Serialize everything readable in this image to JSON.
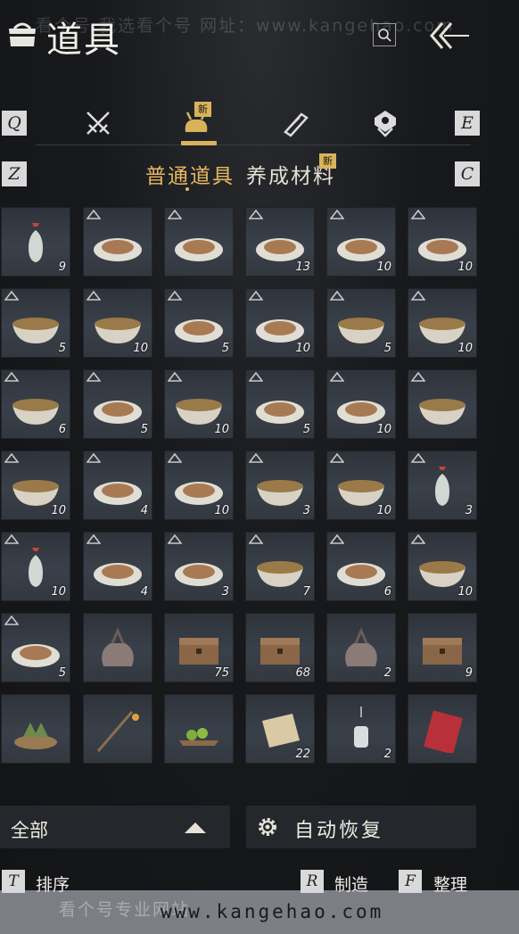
{
  "watermark_top": "看个号 我选看个号  网址：www.kangehao.com",
  "header": {
    "title": "道具"
  },
  "category_tabs": {
    "left_key": "Q",
    "right_key": "E",
    "new_badge": "新",
    "tabs": [
      {
        "icon": "crossed-swords-icon",
        "active": false
      },
      {
        "icon": "item-bag-icon",
        "active": true
      },
      {
        "icon": "scroll-icon",
        "active": false
      },
      {
        "icon": "map-marker-icon",
        "active": false
      }
    ]
  },
  "sub_tabs": {
    "left_key": "Z",
    "right_key": "C",
    "items": [
      {
        "label": "普通道具",
        "active": true
      },
      {
        "label": "养成材料",
        "active": false,
        "badge": "新"
      }
    ]
  },
  "grid": {
    "items": [
      {
        "icon": "vase-icon",
        "qty": "9",
        "rank": false
      },
      {
        "icon": "braised-pork-icon",
        "qty": "",
        "rank": true
      },
      {
        "icon": "tofu-bites-icon",
        "qty": "",
        "rank": true
      },
      {
        "icon": "flatbread-icon",
        "qty": "13",
        "rank": true
      },
      {
        "icon": "fish-dish-icon",
        "qty": "10",
        "rank": true
      },
      {
        "icon": "fish-dish-icon",
        "qty": "10",
        "rank": true
      },
      {
        "icon": "vegetable-bowl-icon",
        "qty": "5",
        "rank": true
      },
      {
        "icon": "vegetable-bowl-icon",
        "qty": "10",
        "rank": true
      },
      {
        "icon": "pancake-stack-icon",
        "qty": "5",
        "rank": true
      },
      {
        "icon": "steamed-bun-icon",
        "qty": "10",
        "rank": true
      },
      {
        "icon": "noodle-bowl-icon",
        "qty": "5",
        "rank": true
      },
      {
        "icon": "noodle-bowl-icon",
        "qty": "10",
        "rank": true
      },
      {
        "icon": "soup-bowl-icon",
        "qty": "6",
        "rank": true
      },
      {
        "icon": "red-dish-icon",
        "qty": "5",
        "rank": true
      },
      {
        "icon": "cup-soup-icon",
        "qty": "10",
        "rank": true
      },
      {
        "icon": "meat-plate-icon",
        "qty": "5",
        "rank": true
      },
      {
        "icon": "greens-plate-icon",
        "qty": "10",
        "rank": true
      },
      {
        "icon": "stew-bowl-icon",
        "qty": "",
        "rank": true
      },
      {
        "icon": "porridge-bowl-icon",
        "qty": "10",
        "rank": true
      },
      {
        "icon": "tofu-plate-icon",
        "qty": "4",
        "rank": true
      },
      {
        "icon": "stir-fry-plate-icon",
        "qty": "10",
        "rank": true
      },
      {
        "icon": "bean-soup-icon",
        "qty": "3",
        "rank": true
      },
      {
        "icon": "clay-bowl-icon",
        "qty": "10",
        "rank": true
      },
      {
        "icon": "vase-icon",
        "qty": "3",
        "rank": true
      },
      {
        "icon": "vase-icon",
        "qty": "10",
        "rank": true
      },
      {
        "icon": "noodle-plate-icon",
        "qty": "4",
        "rank": true
      },
      {
        "icon": "mixed-plate-icon",
        "qty": "3",
        "rank": true
      },
      {
        "icon": "clay-pot-icon",
        "qty": "7",
        "rank": true
      },
      {
        "icon": "braised-pork-icon",
        "qty": "6",
        "rank": true
      },
      {
        "icon": "custard-bowl-icon",
        "qty": "10",
        "rank": true
      },
      {
        "icon": "tofu-bites-icon",
        "qty": "5",
        "rank": true
      },
      {
        "icon": "cloth-sack-icon",
        "qty": "",
        "rank": false
      },
      {
        "icon": "wooden-chest-icon",
        "qty": "75",
        "rank": false
      },
      {
        "icon": "wooden-chest-icon",
        "qty": "68",
        "rank": false
      },
      {
        "icon": "cloth-sack-icon",
        "qty": "2",
        "rank": false
      },
      {
        "icon": "wooden-chest-icon",
        "qty": "9",
        "rank": false
      },
      {
        "icon": "zongzi-steamer-icon",
        "qty": "",
        "rank": false
      },
      {
        "icon": "lantern-pole-icon",
        "qty": "",
        "rank": false
      },
      {
        "icon": "green-fruit-tray-icon",
        "qty": "",
        "rank": false
      },
      {
        "icon": "parchment-icon",
        "qty": "22",
        "rank": false
      },
      {
        "icon": "hanging-lantern-icon",
        "qty": "2",
        "rank": false
      },
      {
        "icon": "red-envelope-icon",
        "qty": "",
        "rank": false
      }
    ]
  },
  "bottom": {
    "filter_label": "全部",
    "auto_restore_label": "自动恢复",
    "hotkeys": [
      {
        "key": "T",
        "label": "排序"
      },
      {
        "key": "R",
        "label": "制造"
      },
      {
        "key": "F",
        "label": "整理"
      }
    ]
  },
  "watermark_bottom": "www.kangehao.com",
  "watermark_bottom_faint": "看个号专业网站"
}
